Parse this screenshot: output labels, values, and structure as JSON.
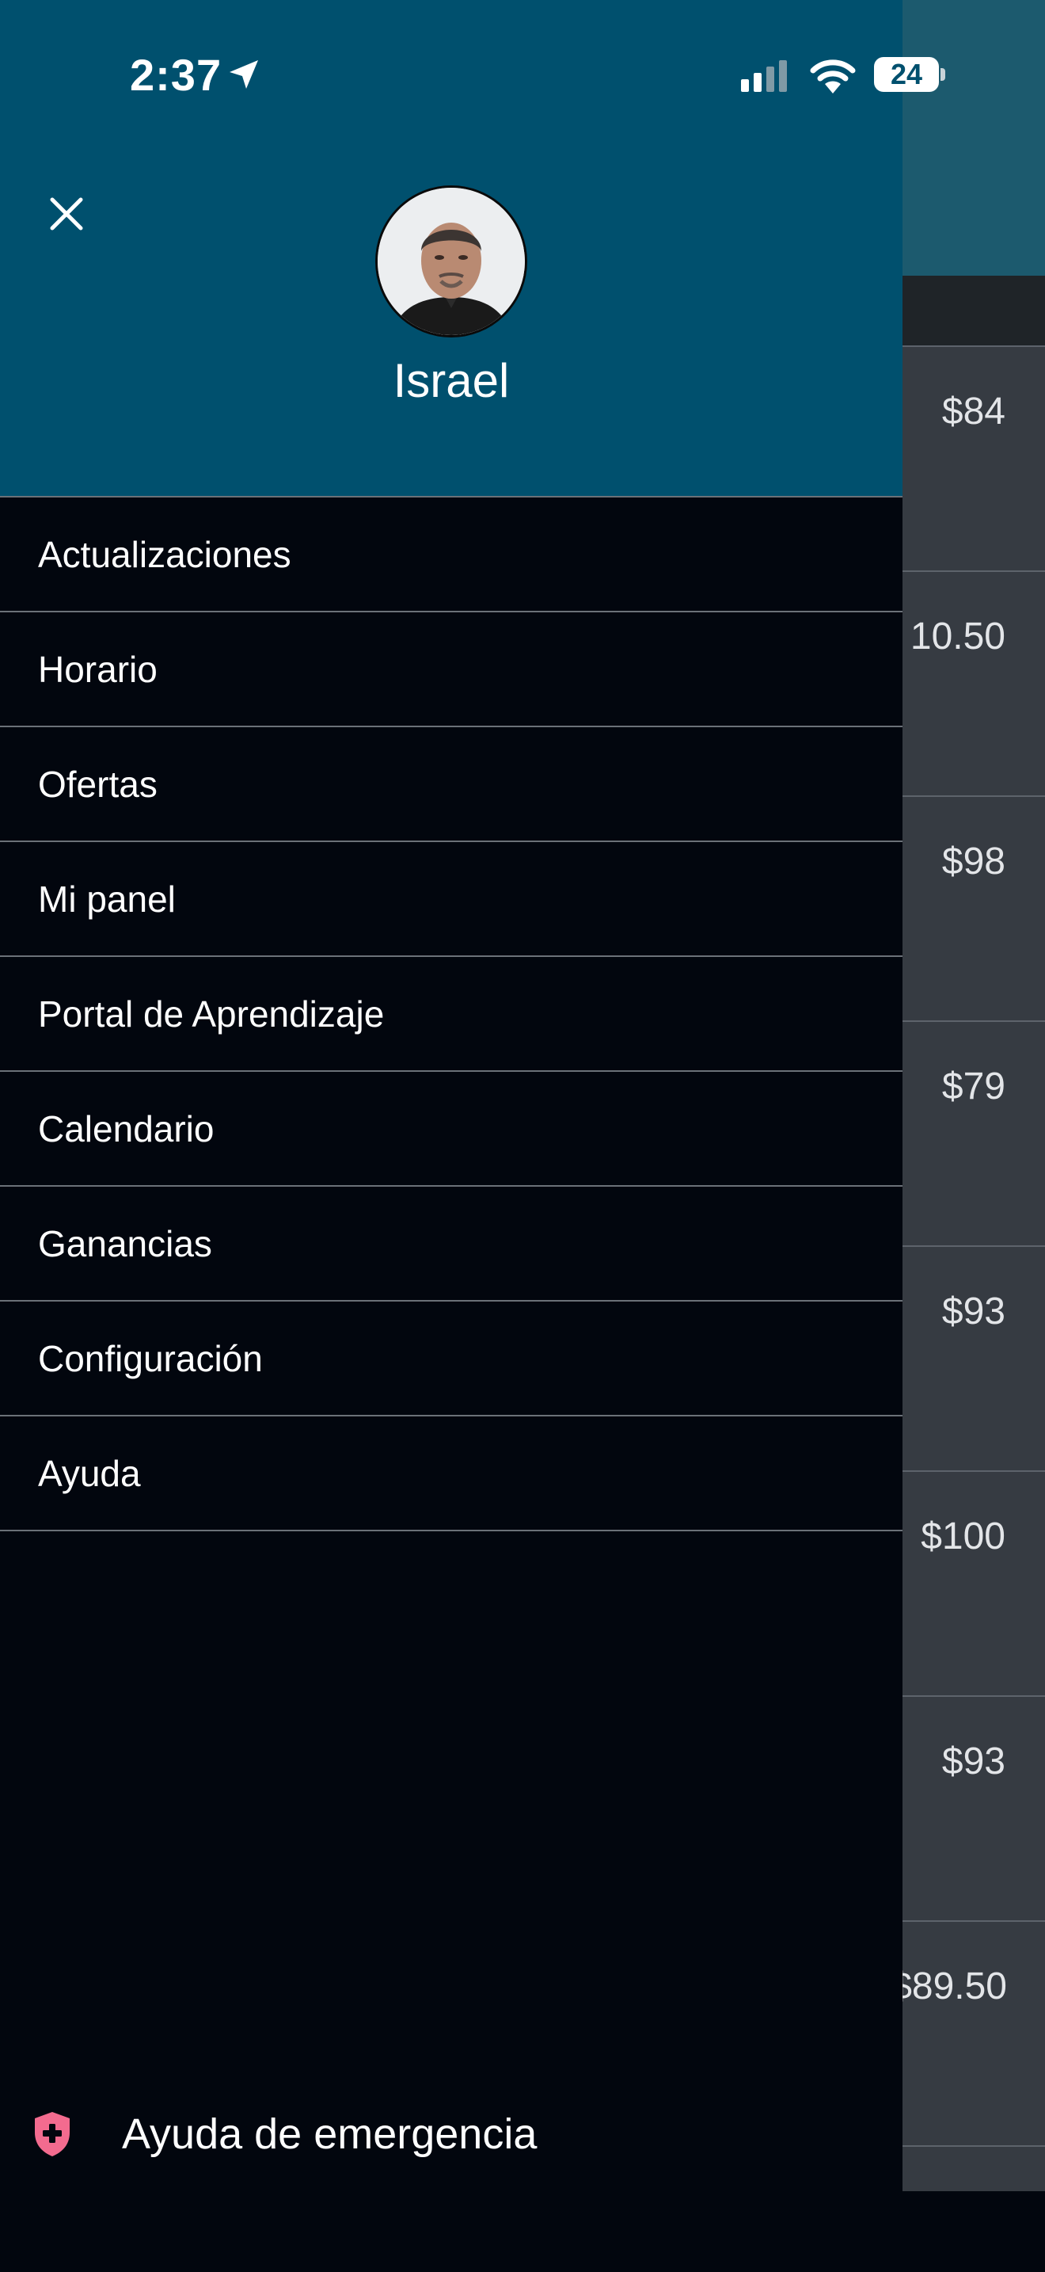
{
  "status_bar": {
    "time": "2:37",
    "battery": "24"
  },
  "drawer": {
    "user_name": "Israel",
    "menu_items": [
      {
        "label": "Actualizaciones"
      },
      {
        "label": "Horario"
      },
      {
        "label": "Ofertas"
      },
      {
        "label": "Mi panel"
      },
      {
        "label": "Portal de Aprendizaje"
      },
      {
        "label": "Calendario"
      },
      {
        "label": "Ganancias"
      },
      {
        "label": "Configuración"
      },
      {
        "label": "Ayuda"
      }
    ],
    "emergency_label": "Ayuda de emergencia"
  },
  "background_list": {
    "prices": [
      "$84",
      "10.50",
      "$98",
      "$79",
      "$93",
      "$100",
      "$93",
      "$89.50"
    ]
  },
  "colors": {
    "header": "#00506e",
    "drawer_bg": "#02060e",
    "divider": "#6b7178",
    "emergency_icon": "#f36b8f"
  },
  "icons": {
    "close": "close-icon",
    "location": "location-arrow-icon",
    "signal": "cellular-signal-icon",
    "wifi": "wifi-icon",
    "emergency": "shield-plus-icon"
  }
}
